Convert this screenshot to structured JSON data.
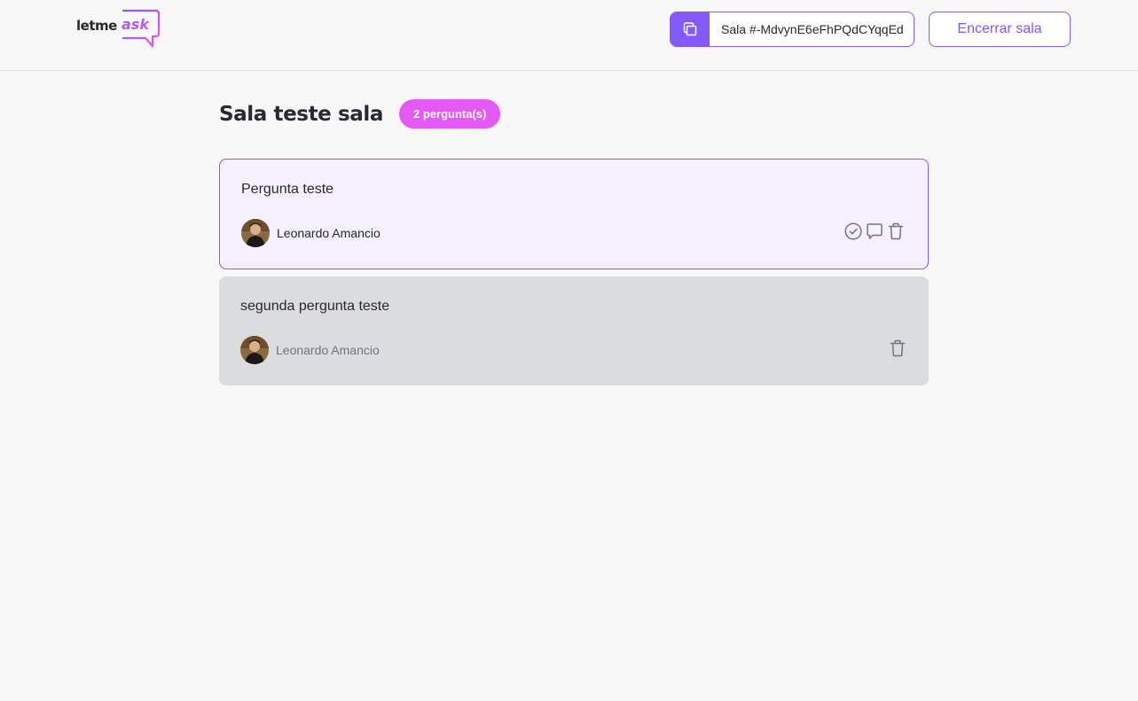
{
  "header": {
    "logo": {
      "word1": "letme",
      "word2": "ask"
    },
    "room_code": {
      "label": "Sala #-MdvynE6eFhPQdCYqqEd",
      "icon": "copy-icon"
    },
    "close_room_label": "Encerrar sala"
  },
  "room": {
    "title": "Sala teste sala",
    "badge": "2 pergunta(s)"
  },
  "questions": [
    {
      "content": "Pergunta teste",
      "author": "Leonardo Amancio",
      "highlighted": true,
      "actions": [
        "check-circle-icon",
        "answer-icon",
        "delete-icon"
      ]
    },
    {
      "content": "segunda pergunta teste",
      "author": "Leonardo Amancio",
      "answered": true,
      "actions": [
        "delete-icon"
      ]
    }
  ],
  "colors": {
    "accent": "#835afd",
    "badge": "#e559f9",
    "highlight_bg": "#f4f0ff",
    "answered_bg": "#dbdcdd",
    "page_bg": "#f8f8f8"
  }
}
